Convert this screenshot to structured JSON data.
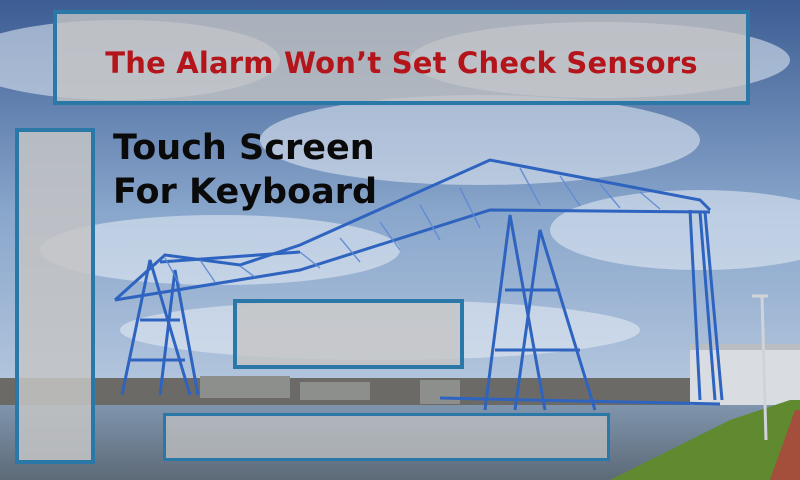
{
  "alarm": {
    "message": "The Alarm Won’t Set Check Sensors"
  },
  "touch_hint": {
    "line1": "Touch Screen",
    "line2": "For Keyboard"
  },
  "colors": {
    "accent_border": "#2a78a8",
    "alert_text": "#b4151a",
    "bridge": "#2e64c0"
  }
}
